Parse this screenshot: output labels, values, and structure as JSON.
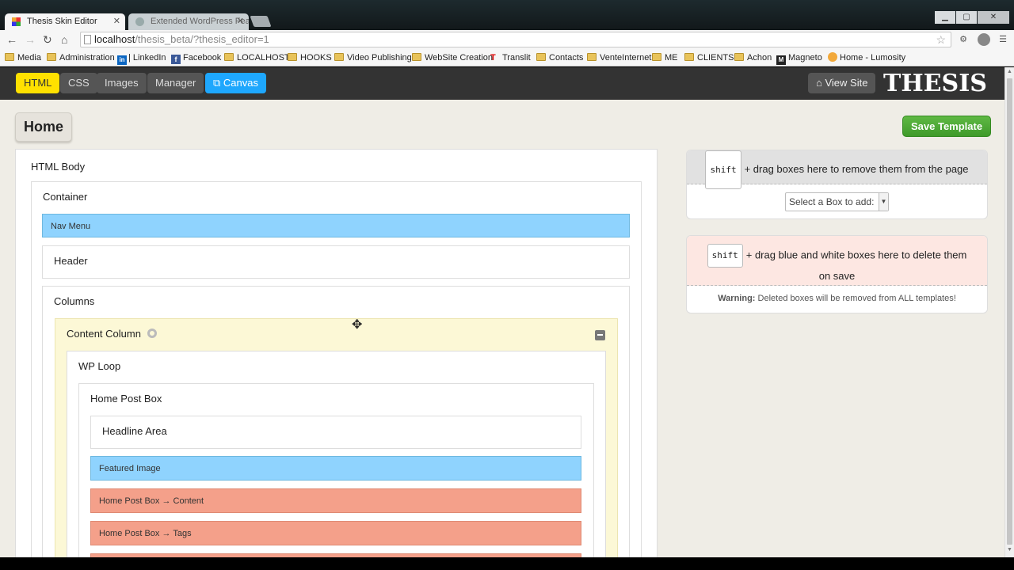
{
  "browser": {
    "tabs": [
      {
        "title": "Thesis Skin Editor",
        "active": true
      },
      {
        "title": "Extended WordPress Feat",
        "active": false
      }
    ],
    "url_host": "localhost",
    "url_path": "/thesis_beta/?thesis_editor=1",
    "bookmarks": [
      "Media",
      "Administration",
      "LinkedIn",
      "Facebook",
      "LOCALHOST",
      "HOOKS",
      "Video Publishing",
      "WebSite Creation",
      "Translit",
      "Contacts",
      "VenteInternet",
      "ME",
      "CLIENTS",
      "Achon",
      "Magneto",
      "Home - Lumosity"
    ],
    "linkedin_prefix": "in",
    "facebook_prefix": "f",
    "magneto_prefix": "M"
  },
  "appbar": {
    "buttons": [
      "HTML",
      "CSS",
      "Images",
      "Manager",
      "Canvas"
    ],
    "view_site": "View Site",
    "logo": "THESIS"
  },
  "page": {
    "template_name": "Home",
    "save_label": "Save Template"
  },
  "tree": {
    "html_body": "HTML Body",
    "container": "Container",
    "nav_menu": "Nav Menu",
    "header": "Header",
    "columns": "Columns",
    "content_column": "Content Column",
    "wp_loop": "WP Loop",
    "home_post_box": "Home Post Box",
    "headline_area": "Headline Area",
    "featured_image": "Featured Image",
    "post_content": "Home Post Box → Content",
    "post_tags": "Home Post Box → Tags"
  },
  "remove_panel": {
    "key": "shift",
    "text": "+ drag boxes here to remove them from the page",
    "select_placeholder": "Select a Box to add:"
  },
  "delete_panel": {
    "key": "shift",
    "text": "+ drag blue and white boxes here to delete them on save",
    "warning_label": "Warning:",
    "warning_text": "Deleted boxes will be removed from ALL templates!"
  },
  "colors": {
    "blue_box": "#8fd3fe",
    "red_box": "#f4a08a",
    "yellow_box": "#fcf8d6",
    "save_green": "#4caf34",
    "html_yellow": "#ffe100",
    "canvas_blue": "#1ea7fd"
  }
}
